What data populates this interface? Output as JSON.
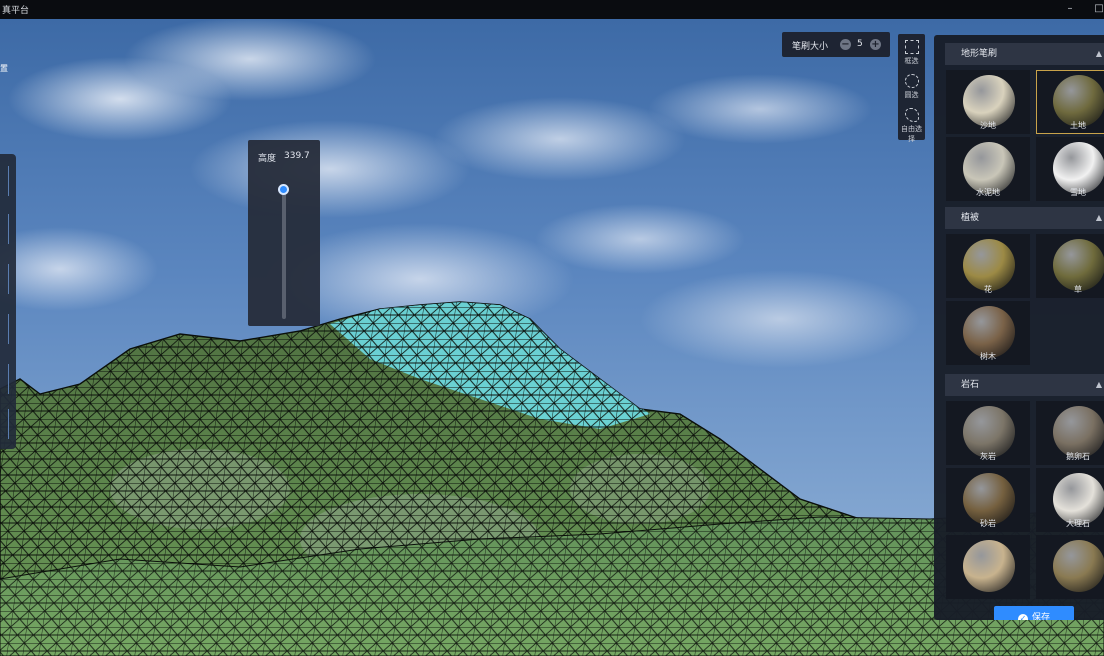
{
  "app": {
    "title": "真平台"
  },
  "window_controls": {
    "minimize": "–",
    "maximize": "□"
  },
  "left": {
    "label": "置"
  },
  "height_control": {
    "label": "高度",
    "value": "339.7",
    "level_fraction": 0.02
  },
  "brush": {
    "label": "笔刷大小",
    "value": "5",
    "minus": "−",
    "plus": "+"
  },
  "tools": [
    {
      "name": "rect-select",
      "label": "框选"
    },
    {
      "name": "circle-select",
      "label": "圆选"
    },
    {
      "name": "free-select",
      "label": "自由选择"
    }
  ],
  "panel": {
    "sections": [
      {
        "title": "地形笔刷",
        "items": [
          {
            "label": "沙地",
            "color": "#d9d2bd",
            "selected": false
          },
          {
            "label": "土地",
            "color": "#6f6a3e",
            "selected": true
          },
          {
            "label": "水泥地",
            "color": "#c9c6b8",
            "selected": false
          },
          {
            "label": "雪地",
            "color": "#f1f1f1",
            "selected": false
          }
        ]
      },
      {
        "title": "植被",
        "items": [
          {
            "label": "花",
            "color": "#9c8a45"
          },
          {
            "label": "草",
            "color": "#6f6b3c"
          },
          {
            "label": "树木",
            "color": "#7a6248"
          }
        ]
      },
      {
        "title": "岩石",
        "items": [
          {
            "label": "灰岩",
            "color": "#7c7568"
          },
          {
            "label": "鹅卵石",
            "color": "#7a7062"
          },
          {
            "label": "砂岩",
            "color": "#75603f"
          },
          {
            "label": "大理石",
            "color": "#e4e1da"
          },
          {
            "label": "",
            "color": "#c8b38e"
          },
          {
            "label": "",
            "color": "#8a7a52"
          }
        ]
      }
    ],
    "save_label": "保存",
    "caret": "▲"
  },
  "colors": {
    "accent": "#2f8cff",
    "selection": "#c9a34a",
    "highlight": "#6fe0ec",
    "terrain": "#5f8a4e"
  }
}
